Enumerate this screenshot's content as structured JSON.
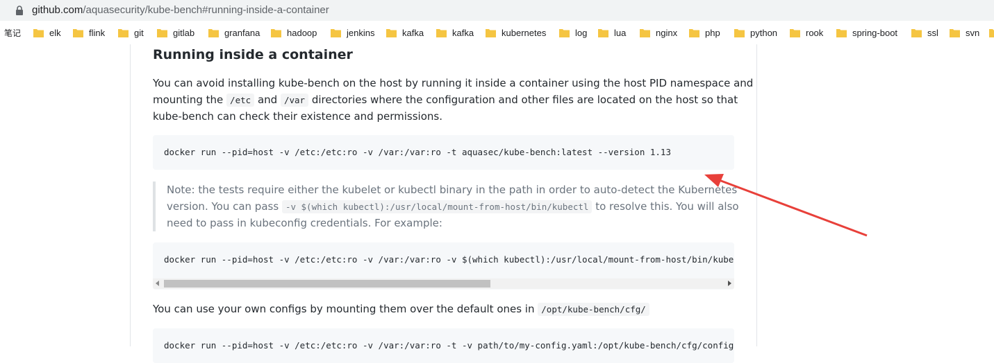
{
  "browser": {
    "url_host": "github.com",
    "url_path": "/aquasecurity/kube-bench#running-inside-a-container"
  },
  "bookmarks": [
    {
      "label": "笔记",
      "folder": false
    },
    {
      "label": "elk",
      "folder": true
    },
    {
      "label": "flink",
      "folder": true
    },
    {
      "label": "git",
      "folder": true
    },
    {
      "label": "gitlab",
      "folder": true
    },
    {
      "label": "granfana",
      "folder": true
    },
    {
      "label": "hadoop",
      "folder": true
    },
    {
      "label": "jenkins",
      "folder": true
    },
    {
      "label": "kafka",
      "folder": true
    },
    {
      "label": "kafka",
      "folder": true
    },
    {
      "label": "kubernetes",
      "folder": true
    },
    {
      "label": "log",
      "folder": true
    },
    {
      "label": "lua",
      "folder": true
    },
    {
      "label": "nginx",
      "folder": true
    },
    {
      "label": "php",
      "folder": true
    },
    {
      "label": "python",
      "folder": true
    },
    {
      "label": "rook",
      "folder": true
    },
    {
      "label": "spring-boot",
      "folder": true
    },
    {
      "label": "ssl",
      "folder": true
    },
    {
      "label": "svn",
      "folder": true
    }
  ],
  "article": {
    "heading": "Running inside a container",
    "para1": {
      "line1": "You can avoid installing kube-bench on the host by running it inside a container using the host PID namespace and",
      "line2_a": "mounting the",
      "line2_code1": "/etc",
      "line2_b": "and",
      "line2_code2": "/var",
      "line2_c": "directories where the configuration and other files are located on the host so that",
      "line3": "kube-bench can check their existence and permissions."
    },
    "code1": "docker run --pid=host -v /etc:/etc:ro -v /var:/var:ro -t aquasec/kube-bench:latest --version 1.13",
    "note": {
      "line1": "Note: the tests require either the kubelet or kubectl binary in the path in order to auto-detect the Kubernetes",
      "line2_a": "version. You can pass",
      "line2_code": "-v $(which kubectl):/usr/local/mount-from-host/bin/kubectl",
      "line2_b": "to resolve this. You will also",
      "line3": "need to pass in kubeconfig credentials. For example:"
    },
    "code2": "docker run --pid=host -v /etc:/etc:ro -v /var:/var:ro -v $(which kubectl):/usr/local/mount-from-host/bin/kubectl -v ~/.kube:/.kube -e KUBECONFIG=/.kube/config -t aquasec/kube-bench:latest",
    "para2_text": "You can use your own configs by mounting them over the default ones in",
    "para2_code": "/opt/kube-bench/cfg/",
    "code3": "docker run --pid=host -v /etc:/etc:ro -v /var:/var:ro -t -v path/to/my-config.yaml:/opt/kube-bench/cfg/config.yaml aquasec/kube-bench:latest"
  },
  "annotation": {
    "arrow_color": "#e8403a"
  }
}
